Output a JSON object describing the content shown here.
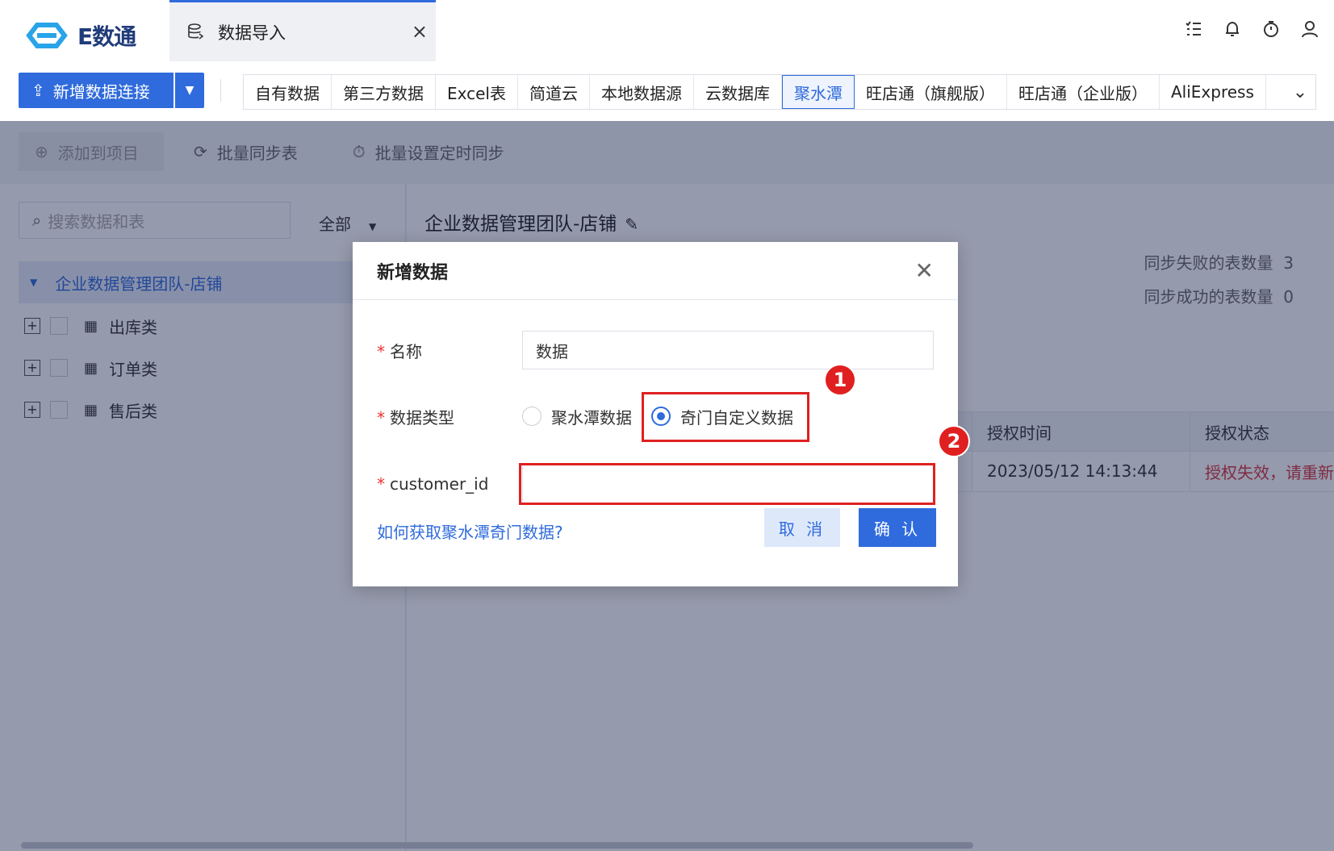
{
  "app": {
    "logo_text": "E数通"
  },
  "tab": {
    "label": "数据导入",
    "close": "×"
  },
  "header_icons": [
    "list-check-icon",
    "bell-icon",
    "timer-icon",
    "user-icon"
  ],
  "toolbar_top": {
    "add_connection": "新增数据连接",
    "sources": [
      "自有数据",
      "第三方数据",
      "Excel表",
      "简道云",
      "本地数据源",
      "云数据库",
      "聚水潭",
      "旺店通（旗舰版）",
      "旺店通（企业版）",
      "AliExpress"
    ],
    "active_source": "聚水潭"
  },
  "toolbar": {
    "add_to_project": "添加到项目",
    "batch_sync": "批量同步表",
    "batch_timer": "批量设置定时同步"
  },
  "left": {
    "search_placeholder": "搜索数据和表",
    "filter": "全部",
    "root": "企业数据管理团队-店铺",
    "items": [
      "出库类",
      "订单类",
      "售后类"
    ]
  },
  "right": {
    "title": "企业数据管理团队-店铺",
    "stat_fail_label": "同步失败的表数量",
    "stat_fail_value": "3",
    "stat_success_label": "同步成功的表数量",
    "stat_success_value": "0",
    "table": {
      "headers": {
        "time": "授权时间",
        "status": "授权状态"
      },
      "rows": [
        {
          "time": "2023/05/12 14:13:44",
          "status": "授权失效，请重新授权"
        }
      ]
    }
  },
  "dialog": {
    "title": "新增数据",
    "name_label": "名称",
    "name_value": "数据",
    "type_label": "数据类型",
    "type_options": [
      "聚水潭数据",
      "奇门自定义数据"
    ],
    "type_selected": "奇门自定义数据",
    "customer_label": "customer_id",
    "customer_value": "",
    "help_link": "如何获取聚水潭奇门数据?",
    "cancel": "取 消",
    "confirm": "确 认"
  },
  "annotations": {
    "badge1": "1",
    "badge2": "2"
  },
  "colors": {
    "primary": "#2f6bdc",
    "highlight": "#e02020",
    "error": "#d9363e"
  }
}
